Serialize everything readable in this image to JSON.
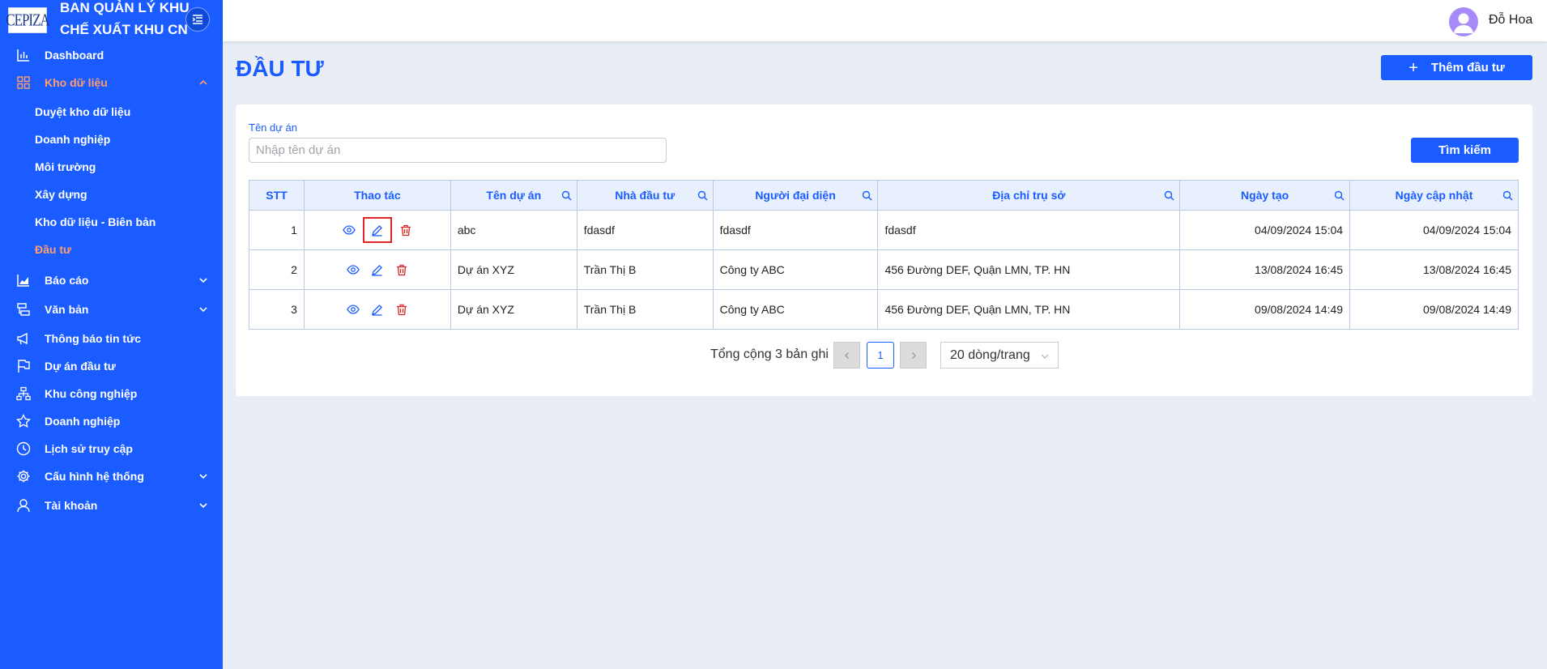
{
  "brand": {
    "logo_text": "CEPIZA",
    "org_line1": "BAN QUẢN LÝ KHU",
    "org_line2": "CHẾ XUẤT KHU CN"
  },
  "sidebar": {
    "items": [
      {
        "label": "Dashboard",
        "icon": "bar-chart-icon"
      },
      {
        "label": "Kho dữ liệu",
        "icon": "grid-icon",
        "active": true,
        "expanded": true
      },
      {
        "label": "Báo cáo",
        "icon": "area-chart-icon"
      },
      {
        "label": "Văn bản",
        "icon": "document-flow-icon"
      },
      {
        "label": "Thông báo tin tức",
        "icon": "megaphone-icon"
      },
      {
        "label": "Dự án đầu tư",
        "icon": "flag-icon"
      },
      {
        "label": "Khu công nghiệp",
        "icon": "hierarchy-icon"
      },
      {
        "label": "Doanh nghiệp",
        "icon": "star-icon"
      },
      {
        "label": "Lịch sử truy cập",
        "icon": "clock-icon"
      },
      {
        "label": "Cấu hình hệ thống",
        "icon": "gear-icon"
      },
      {
        "label": "Tài khoản",
        "icon": "user-icon"
      }
    ],
    "subitems": [
      {
        "label": "Duyệt kho dữ liệu"
      },
      {
        "label": "Doanh nghiệp"
      },
      {
        "label": "Môi trường"
      },
      {
        "label": "Xây dựng"
      },
      {
        "label": "Kho dữ liệu - Biên bản"
      },
      {
        "label": "Đầu tư",
        "active": true
      }
    ]
  },
  "header": {
    "username": "Đỗ Hoa"
  },
  "page": {
    "title": "ĐẦU TƯ",
    "add_button": "Thêm đầu tư"
  },
  "filter": {
    "label": "Tên dự án",
    "placeholder": "Nhập tên dự án",
    "search_button": "Tìm kiếm"
  },
  "table": {
    "columns": [
      "STT",
      "Thao tác",
      "Tên dự án",
      "Nhà đầu tư",
      "Người đại diện",
      "Địa chỉ trụ sở",
      "Ngày tạo",
      "Ngày cập nhật"
    ],
    "rows": [
      {
        "stt": "1",
        "ten_du_an": "abc",
        "nha_dau_tu": "fdasdf",
        "nguoi_dai_dien": "fdasdf",
        "dia_chi": "fdasdf",
        "ngay_tao": "04/09/2024 15:04",
        "ngay_cap_nhat": "04/09/2024 15:04"
      },
      {
        "stt": "2",
        "ten_du_an": "Dự án XYZ",
        "nha_dau_tu": "Trần Thị B",
        "nguoi_dai_dien": "Công ty ABC",
        "dia_chi": "456 Đường DEF, Quận LMN, TP. HN",
        "ngay_tao": "13/08/2024 16:45",
        "ngay_cap_nhat": "13/08/2024 16:45"
      },
      {
        "stt": "3",
        "ten_du_an": "Dự án XYZ",
        "nha_dau_tu": "Trần Thị B",
        "nguoi_dai_dien": "Công ty ABC",
        "dia_chi": "456 Đường DEF, Quận LMN, TP. HN",
        "ngay_tao": "09/08/2024 14:49",
        "ngay_cap_nhat": "09/08/2024 14:49"
      }
    ]
  },
  "pagination": {
    "total_text": "Tổng cộng 3 bản ghi",
    "current_page": "1",
    "page_size": "20 dòng/trang"
  },
  "colors": {
    "primary": "#1a5cff",
    "active_nav": "#ff9e6b",
    "danger": "#e02424",
    "background": "#e9eef6"
  }
}
